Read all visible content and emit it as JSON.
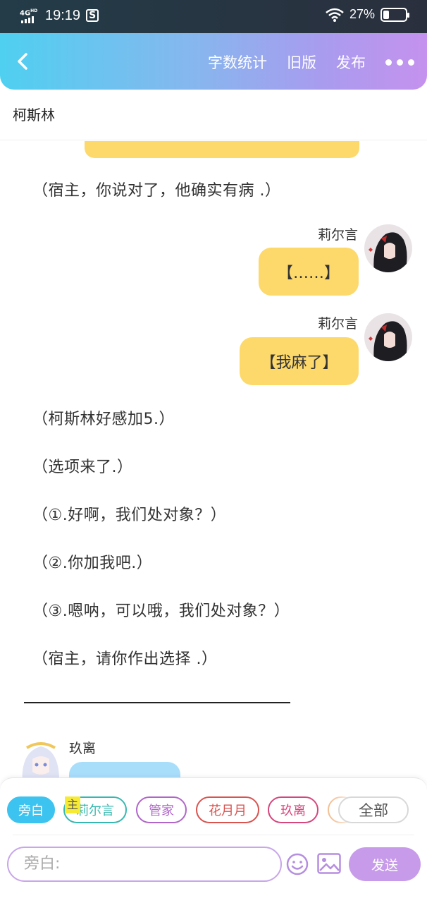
{
  "status_bar": {
    "network": "4G",
    "network_sup": "HD",
    "time": "19:19",
    "battery_percent": "27%",
    "battery_level": 0.27
  },
  "header": {
    "actions": [
      "字数统计",
      "旧版",
      "发布"
    ]
  },
  "book_title": "柯斯林",
  "messages": {
    "narration": [
      "（宿主，你说对了，他确实有病 .）",
      "（柯斯林好感加5.）",
      "（选项来了.）",
      "（①.好啊，我们处对象？）",
      "（②.你加我吧.）",
      "（③.嗯呐，可以哦，我们处对象？）",
      "（宿主，请你作出选择 .）"
    ],
    "right_1": {
      "speaker": "莉尔言",
      "text": "【……】"
    },
    "right_2": {
      "speaker": "莉尔言",
      "text": "【我麻了】"
    },
    "left_1": {
      "speaker": "玖离"
    }
  },
  "composer": {
    "characters": [
      {
        "label": "旁白",
        "color": "#3cc3ef",
        "filled": true
      },
      {
        "label": "莉尔言",
        "color": "#36b8b0",
        "filled": false,
        "tag": "主"
      },
      {
        "label": "管家",
        "color": "#b065c9",
        "filled": false
      },
      {
        "label": "花月月",
        "color": "#d9534f",
        "filled": false
      },
      {
        "label": "玖离",
        "color": "#d6467c",
        "filled": false
      }
    ],
    "all_label": "全部",
    "input_placeholder": "旁白:",
    "send_label": "发送"
  }
}
